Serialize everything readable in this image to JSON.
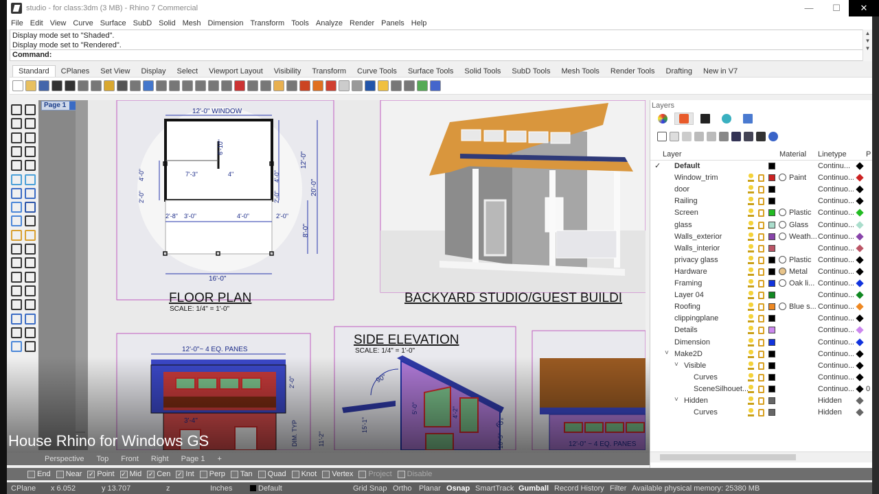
{
  "window": {
    "title": "studio - for class:3dm (3 MB) - Rhino 7 Commercial",
    "min": "—",
    "max": "☐",
    "close": "✕"
  },
  "menu": [
    "File",
    "Edit",
    "View",
    "Curve",
    "Surface",
    "SubD",
    "Solid",
    "Mesh",
    "Dimension",
    "Transform",
    "Tools",
    "Analyze",
    "Render",
    "Panels",
    "Help"
  ],
  "command": {
    "history": [
      "Display mode set to \"Shaded\".",
      "Display mode set to \"Rendered\"."
    ],
    "prompt": "Command:"
  },
  "tabs": [
    "Standard",
    "CPlanes",
    "Set View",
    "Display",
    "Select",
    "Viewport Layout",
    "Visibility",
    "Transform",
    "Curve Tools",
    "Surface Tools",
    "Solid Tools",
    "SubD Tools",
    "Mesh Tools",
    "Render Tools",
    "Drafting",
    "New in V7"
  ],
  "toolbar_colors": [
    "#ffffff",
    "#e8c060",
    "#4466aa",
    "#333333",
    "#333333",
    "#777777",
    "#777777",
    "#d9a830",
    "#555555",
    "#777777",
    "#4477cc",
    "#777777",
    "#777777",
    "#777777",
    "#777777",
    "#777777",
    "#777777",
    "#cc3333",
    "#777777",
    "#777777",
    "#e8b050",
    "#777777",
    "#cc4422",
    "#e07020",
    "#d04030",
    "#cccccc",
    "#999999",
    "#2255aa",
    "#f0c040",
    "#777777",
    "#777777",
    "#55aa55",
    "#4466cc"
  ],
  "page": {
    "tab_label": "Page 1"
  },
  "drawing": {
    "floor_plan_title": "FLOOR PLAN",
    "floor_plan_scale": "SCALE: 1/4\" = 1'-0\"",
    "dims": {
      "window": "12'-0\" WINDOW",
      "d610": "6'-10\"",
      "d73": "7'-3\"",
      "d4": "4\"",
      "d40a": "4'-0\"",
      "d20a": "2'-0\"",
      "d120": "12'-0\"",
      "d200": "20'-0\"",
      "d40b": "4'-0\"",
      "d20b": "2'-0\"",
      "d28": "2'-8\"",
      "d30": "3'-0\"",
      "d40c": "4'-0\"",
      "d20c": "2'-0\"",
      "d80": "8'-0\"",
      "d160": "16'-0\"",
      "panes": "12'-0\"~ 4 EQ. PANES",
      "panes2": "12'-0\" ~ 4 EQ. PANES",
      "d34": "3'-4\"",
      "d20d": "2'-0\"",
      "d90": "90°",
      "d50": "5'-0\"",
      "d42": "4'-2\"",
      "d65": "65°",
      "d1511": "15'-1\"",
      "d112": "11'-2\"",
      "d105": "10'-5\"",
      "dim_typ": "DIM. TYP"
    },
    "studio_title": "BACKYARD STUDIO/GUEST BUILDI",
    "side_title": "SIDE ELEVATION",
    "side_scale": "SCALE: 1/4\" = 1'-0\""
  },
  "overlay_caption": "House Rhino for Windows GS",
  "view_tabs": [
    "Perspective",
    "Top",
    "Front",
    "Right",
    "Page 1",
    "+"
  ],
  "osnaps": [
    {
      "label": "End",
      "checked": false
    },
    {
      "label": "Near",
      "checked": false
    },
    {
      "label": "Point",
      "checked": true
    },
    {
      "label": "Mid",
      "checked": true
    },
    {
      "label": "Cen",
      "checked": true
    },
    {
      "label": "Int",
      "checked": true
    },
    {
      "label": "Perp",
      "checked": false
    },
    {
      "label": "Tan",
      "checked": false
    },
    {
      "label": "Quad",
      "checked": false
    },
    {
      "label": "Knot",
      "checked": false
    },
    {
      "label": "Vertex",
      "checked": false
    },
    {
      "label": "Project",
      "checked": false
    },
    {
      "label": "Disable",
      "checked": false
    }
  ],
  "status": {
    "cplane": "CPlane",
    "x": "x 6.052",
    "y": "y 13.707",
    "z": "z",
    "units": "Inches",
    "layer": "Default",
    "grid_snap": "Grid Snap",
    "ortho": "Ortho",
    "planar": "Planar",
    "osnap": "Osnap",
    "smarttrack": "SmartTrack",
    "gumball": "Gumball",
    "record_history": "Record History",
    "filter": "Filter",
    "memory": "Available physical memory: 25380 MB"
  },
  "layers_panel": {
    "title": "Layers",
    "col_layer": "Layer",
    "col_material": "Material",
    "col_linetype": "Linetype",
    "col_print": "P",
    "rows": [
      {
        "name": "Default",
        "bold": true,
        "current": true,
        "indent": 0,
        "color": "#000000",
        "material": "",
        "linetype": "Continu...",
        "print": "#000000",
        "icons": false
      },
      {
        "name": "Window_trim",
        "indent": 0,
        "color": "#cc2222",
        "material": "Paint",
        "mat_color": "#ffffff",
        "linetype": "Continuo...",
        "print": "#cc2222",
        "icons": true
      },
      {
        "name": "door",
        "indent": 0,
        "color": "#000000",
        "material": "",
        "linetype": "Continuo...",
        "print": "#000000",
        "icons": true
      },
      {
        "name": "Railing",
        "indent": 0,
        "color": "#000000",
        "material": "",
        "linetype": "Continuo...",
        "print": "#000000",
        "icons": true
      },
      {
        "name": "Screen",
        "indent": 0,
        "color": "#22bb22",
        "material": "Plastic",
        "mat_color": "#ffffff",
        "linetype": "Continuo...",
        "print": "#22bb22",
        "icons": true
      },
      {
        "name": "glass",
        "indent": 0,
        "color": "#aaddcc",
        "material": "Glass",
        "mat_color": "#ffffff",
        "linetype": "Continuo...",
        "print": "#aaddcc",
        "icons": true
      },
      {
        "name": "Walls_exterior",
        "indent": 0,
        "color": "#8844aa",
        "material": "Weath...",
        "mat_color": "#ffffff",
        "linetype": "Continuo...",
        "print": "#8844aa",
        "icons": true
      },
      {
        "name": "Walls_interior",
        "indent": 0,
        "color": "#bb5566",
        "material": "",
        "linetype": "Continuo...",
        "print": "#bb5566",
        "icons": true
      },
      {
        "name": "privacy glass",
        "indent": 0,
        "color": "#000000",
        "material": "Plastic",
        "mat_color": "#ffffff",
        "linetype": "Continuo...",
        "print": "#000000",
        "icons": true
      },
      {
        "name": "Hardware",
        "indent": 0,
        "color": "#000000",
        "material": "Metal",
        "mat_color": "#e8c48a",
        "linetype": "Continuo...",
        "print": "#000000",
        "icons": true
      },
      {
        "name": "Framing",
        "indent": 0,
        "color": "#1133dd",
        "material": "Oak li...",
        "mat_color": "#ffffff",
        "linetype": "Continuo...",
        "print": "#1133dd",
        "icons": true
      },
      {
        "name": "Layer 04",
        "indent": 0,
        "color": "#118822",
        "material": "",
        "linetype": "Continuo...",
        "print": "#118822",
        "icons": true
      },
      {
        "name": "Roofing",
        "indent": 0,
        "color": "#ee8822",
        "material": "Blue s...",
        "mat_color": "#ffffff",
        "linetype": "Continuo...",
        "print": "#ee8822",
        "icons": true
      },
      {
        "name": "clippingplane",
        "indent": 0,
        "color": "#000000",
        "material": "",
        "linetype": "Continuo...",
        "print": "#000000",
        "icons": true
      },
      {
        "name": "Details",
        "indent": 0,
        "color": "#cc88ee",
        "material": "",
        "linetype": "Continuo...",
        "print": "#cc88ee",
        "icons": true
      },
      {
        "name": "Dimension",
        "indent": 0,
        "color": "#1133dd",
        "material": "",
        "linetype": "Continuo...",
        "print": "#1133dd",
        "icons": true
      },
      {
        "name": "Make2D",
        "indent": 0,
        "tree": "˅",
        "color": "#000000",
        "material": "",
        "linetype": "Continuo...",
        "print": "#000000",
        "icons": true
      },
      {
        "name": "Visible",
        "indent": 1,
        "tree": "˅",
        "color": "#000000",
        "material": "",
        "linetype": "Continuo...",
        "print": "#000000",
        "icons": true
      },
      {
        "name": "Curves",
        "indent": 2,
        "color": "#000000",
        "material": "",
        "linetype": "Continuo...",
        "print": "#000000",
        "icons": true
      },
      {
        "name": "SceneSilhouet...",
        "indent": 2,
        "color": "#000000",
        "material": "",
        "linetype": "Continuo...",
        "print": "#000000",
        "extra": "0",
        "icons": true
      },
      {
        "name": "Hidden",
        "indent": 1,
        "tree": "˅",
        "color": "#666666",
        "material": "",
        "linetype": "Hidden",
        "print": "#666666",
        "icons": true
      },
      {
        "name": "Curves",
        "indent": 2,
        "color": "#666666",
        "material": "",
        "linetype": "Hidden",
        "print": "#666666",
        "icons": true
      }
    ]
  }
}
